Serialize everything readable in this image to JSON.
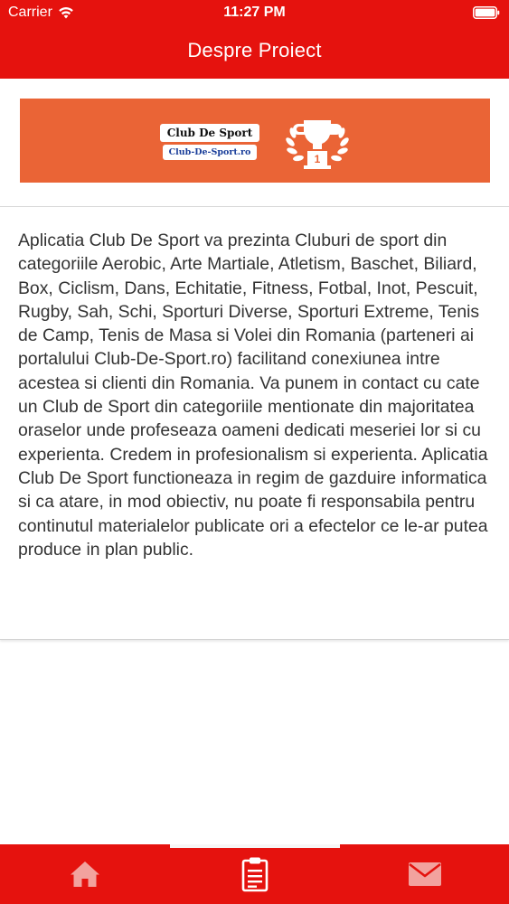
{
  "status_bar": {
    "carrier": "Carrier",
    "time": "11:27 PM"
  },
  "nav": {
    "title": "Despre Proiect"
  },
  "banner": {
    "logo_line1": "Club De Sport",
    "logo_line2": "Club-De-Sport.ro",
    "trophy_number": "1",
    "background_color": "#ea6436"
  },
  "content": {
    "description": "Aplicatia Club De Sport va prezinta Cluburi de sport din categoriile Aerobic, Arte Martiale, Atletism, Baschet, Biliard, Box, Ciclism, Dans, Echitatie, Fitness, Fotbal, Inot, Pescuit, Rugby, Sah, Schi, Sporturi Diverse, Sporturi Extreme, Tenis de Camp, Tenis de Masa si Volei din Romania (parteneri ai portalului Club-De-Sport.ro) facilitand conexiunea intre acestea si clienti din Romania. Va punem in contact cu cate un Club de Sport din categoriile mentionate din majoritatea oraselor unde profeseaza oameni dedicati meseriei lor si cu experienta. Credem in profesionalism si experienta. Aplicatia Club De Sport functioneaza in regim de gazduire informatica si ca atare, in mod obiectiv, nu poate fi responsabila pentru continutul materialelor publicate ori a efectelor ce le-ar putea produce in plan public."
  },
  "tab_bar": {
    "tabs": [
      {
        "icon": "home-icon",
        "selected": false
      },
      {
        "icon": "clipboard-icon",
        "selected": true
      },
      {
        "icon": "mail-icon",
        "selected": false
      }
    ]
  },
  "colors": {
    "primary_red": "#e5120e",
    "inactive_icon": "#f2a29e",
    "text": "#333333"
  }
}
